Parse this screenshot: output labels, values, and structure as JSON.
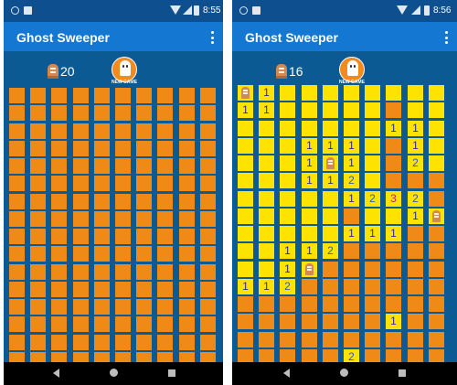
{
  "colors": {
    "statusbar": "#0e4f8f",
    "appbar": "#1477d2",
    "game_bg": "#0b5a94",
    "covered_cell": "#f08a17",
    "open_cell": "#ffe300"
  },
  "screens": [
    {
      "status_time": "8:55",
      "app_title": "Ghost Sweeper",
      "counter": "20",
      "new_game_label": "NEW GAME",
      "grid": [
        "##########",
        "##########",
        "##########",
        "##########",
        "##########",
        "##########",
        "##########",
        "##########",
        "##########",
        "##########",
        "##########",
        "##########",
        "##########",
        "##########",
        "##########",
        "##########"
      ]
    },
    {
      "status_time": "8:56",
      "app_title": "Ghost Sweeper",
      "counter": "16",
      "new_game_label": "NEW GAME",
      "grid": [
        "F1........",
        "11.....#..",
        ".......11.",
        "...111.#1.",
        "...1F1.#2.",
        "...112.###",
        ".....1232#",
        ".....#..1F",
        ".....111##",
        "..112#####",
        "..1F######",
        "112#######",
        "##########",
        "#######1##",
        "##########",
        "#####2####"
      ]
    }
  ],
  "number_colors": {
    "1": "#2b2b9a",
    "2": "#2f5bc4",
    "3": "#c0226a"
  },
  "icons": {
    "counter": "ghost-building-icon",
    "new_game": "ghost-icon",
    "menu": "kebab-menu-icon",
    "nav_back": "back-triangle-icon",
    "nav_home": "home-circle-icon",
    "nav_recent": "recent-square-icon"
  }
}
